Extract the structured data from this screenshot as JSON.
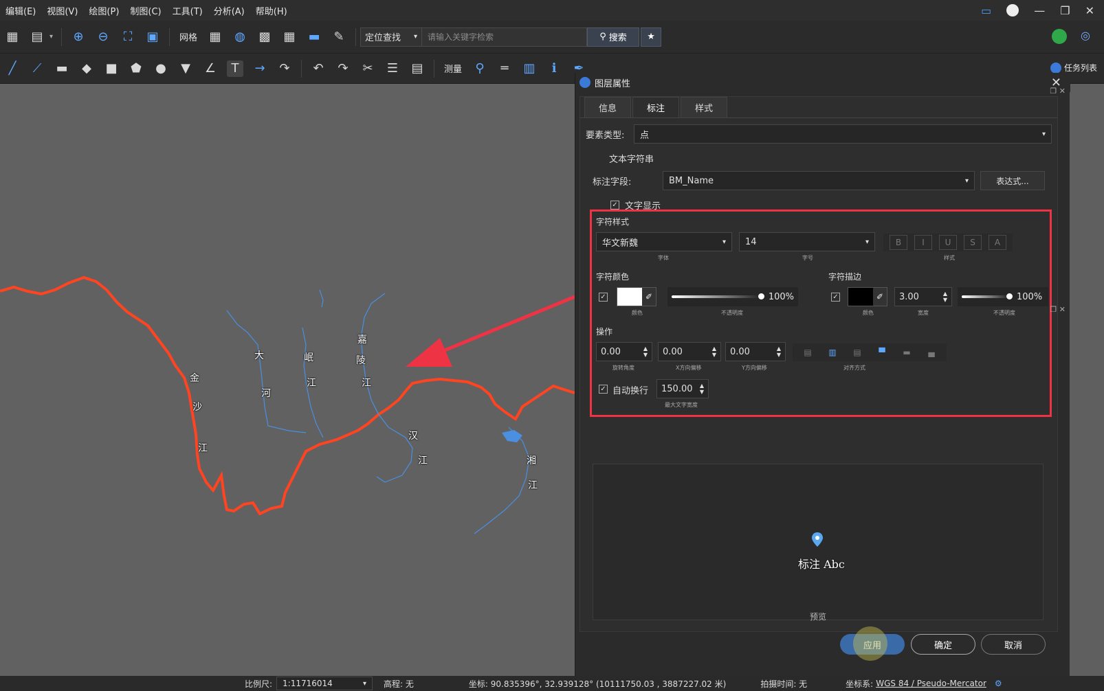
{
  "menu": [
    "编辑(E)",
    "视图(V)",
    "绘图(P)",
    "制图(C)",
    "工具(T)",
    "分析(A)",
    "帮助(H)"
  ],
  "toolbar1": {
    "grid_label": "网格",
    "locate_label": "定位查找",
    "search_placeholder": "请输入关键字检索",
    "search_button": "搜索"
  },
  "toolbar2": {
    "measure_label": "测量",
    "tasklist_label": "任务列表"
  },
  "map": {
    "labels": [
      "金",
      "沙",
      "江",
      "大",
      "河",
      "岷",
      "江",
      "嘉",
      "陵",
      "江",
      "汉",
      "江",
      "湘",
      "江"
    ]
  },
  "dialog": {
    "title": "图层属性",
    "tabs": [
      "信息",
      "标注",
      "样式"
    ],
    "feature_type_label": "要素类型:",
    "feature_type_value": "点",
    "text_string_section": "文本字符串",
    "label_field_label": "标注字段:",
    "label_field_value": "BM_Name",
    "expression_button": "表达式...",
    "text_display_label": "文字显示",
    "char_style_title": "字符样式",
    "font_value": "华文新魏",
    "font_caption": "字体",
    "size_value": "14",
    "size_caption": "字号",
    "style_caption": "样式",
    "style_buttons": [
      "B",
      "I",
      "U",
      "S",
      "A"
    ],
    "char_color_title": "字符颜色",
    "char_color_opacity": "100%",
    "color_caption": "颜色",
    "opacity_caption": "不透明度",
    "char_stroke_title": "字符描边",
    "stroke_width": "3.00",
    "stroke_width_caption": "宽度",
    "stroke_opacity": "100%",
    "operation_title": "操作",
    "rotation": "0.00",
    "rotation_caption": "旋转角度",
    "x_offset": "0.00",
    "x_offset_caption": "X方向偏移",
    "y_offset": "0.00",
    "y_offset_caption": "Y方向偏移",
    "align_caption": "对齐方式",
    "auto_wrap_label": "自动换行",
    "max_width": "150.00",
    "max_width_caption": "最大文字宽度",
    "preview_text": "标注 Abc",
    "preview_label": "预览",
    "apply_button": "应用",
    "ok_button": "确定",
    "cancel_button": "取消"
  },
  "status": {
    "scale_label": "比例尺:",
    "scale_value": "1:11716014",
    "elevation": "高程: 无",
    "coords": "坐标: 90.835396°, 32.939128° (10111750.03 , 3887227.02 米)",
    "capture_time": "拍摄时间: 无",
    "crs_label": "坐标系:",
    "crs_value": "WGS 84 / Pseudo-Mercator"
  },
  "colors": {
    "border_line": "#ff4422",
    "river": "#4a8fe0",
    "highlight": "#ee3344",
    "apply_btn": "#3a6aa8"
  }
}
